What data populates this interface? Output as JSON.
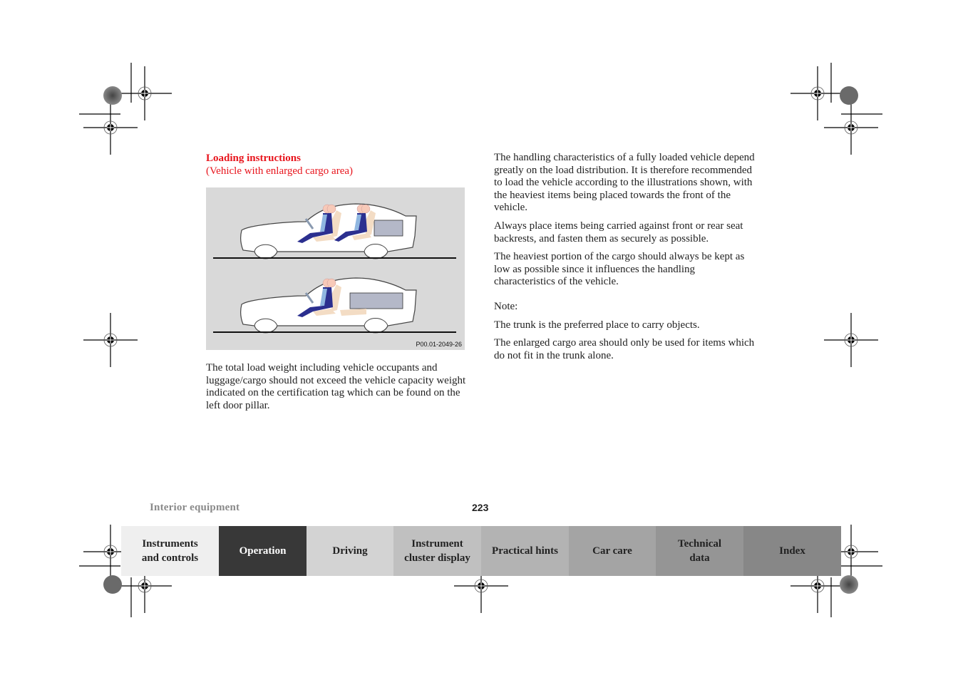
{
  "heading": {
    "title": "Loading instructions",
    "subtitle": "(Vehicle with enlarged cargo area)",
    "color": "#e8141c"
  },
  "figure": {
    "code": "P00.01-2049-26",
    "illustrations": [
      {
        "name": "car-rear-seat-up",
        "description": "Vehicle with front and rear occupants, cargo behind rear seat"
      },
      {
        "name": "car-rear-seat-folded",
        "description": "Vehicle with front occupant, rear seat folded, enlarged cargo area"
      }
    ],
    "colors": {
      "background": "#d9d9d9",
      "occupant": "#2b2f8f",
      "seat": "#f3dcc4",
      "cargo": "#b4b8c8",
      "belt": "#8fb6e0"
    }
  },
  "left_paragraph": "The total load weight including vehicle occupants and luggage/cargo should not exceed the vehicle capacity weight indicated on the certification tag which can be found on the left door pillar.",
  "right_column": {
    "paragraphs": [
      "The handling characteristics of a fully loaded vehicle depend greatly on the load distribution. It is therefore recommended to load the vehicle according to the illustrations shown, with the heaviest items being placed towards the front of the vehicle.",
      "Always place items being carried against front or rear seat backrests, and fasten them as securely as possible.",
      "The heaviest portion of the cargo should always be kept as low as possible since it influences the handling characteristics of the vehicle."
    ],
    "note_label": "Note:",
    "note_paragraphs": [
      "The trunk is the preferred place to carry objects.",
      "The enlarged cargo area should only be used for items which do not fit in the trunk alone."
    ]
  },
  "footer": {
    "section": "Interior equipment",
    "page_number": "223"
  },
  "tabs": [
    {
      "label_line1": "Instruments",
      "label_line2": "and controls",
      "bg": "#efefef",
      "active": false
    },
    {
      "label_line1": "Operation",
      "label_line2": "",
      "bg": "#383838",
      "active": true
    },
    {
      "label_line1": "Driving",
      "label_line2": "",
      "bg": "#d3d3d3",
      "active": false
    },
    {
      "label_line1": "Instrument",
      "label_line2": "cluster display",
      "bg": "#c0c0c0",
      "active": false
    },
    {
      "label_line1": "Practical hints",
      "label_line2": "",
      "bg": "#b3b3b3",
      "active": false
    },
    {
      "label_line1": "Car care",
      "label_line2": "",
      "bg": "#a4a4a4",
      "active": false
    },
    {
      "label_line1": "Technical",
      "label_line2": "data",
      "bg": "#959595",
      "active": false
    },
    {
      "label_line1": "Index",
      "label_line2": "",
      "bg": "#878787",
      "active": false
    }
  ]
}
